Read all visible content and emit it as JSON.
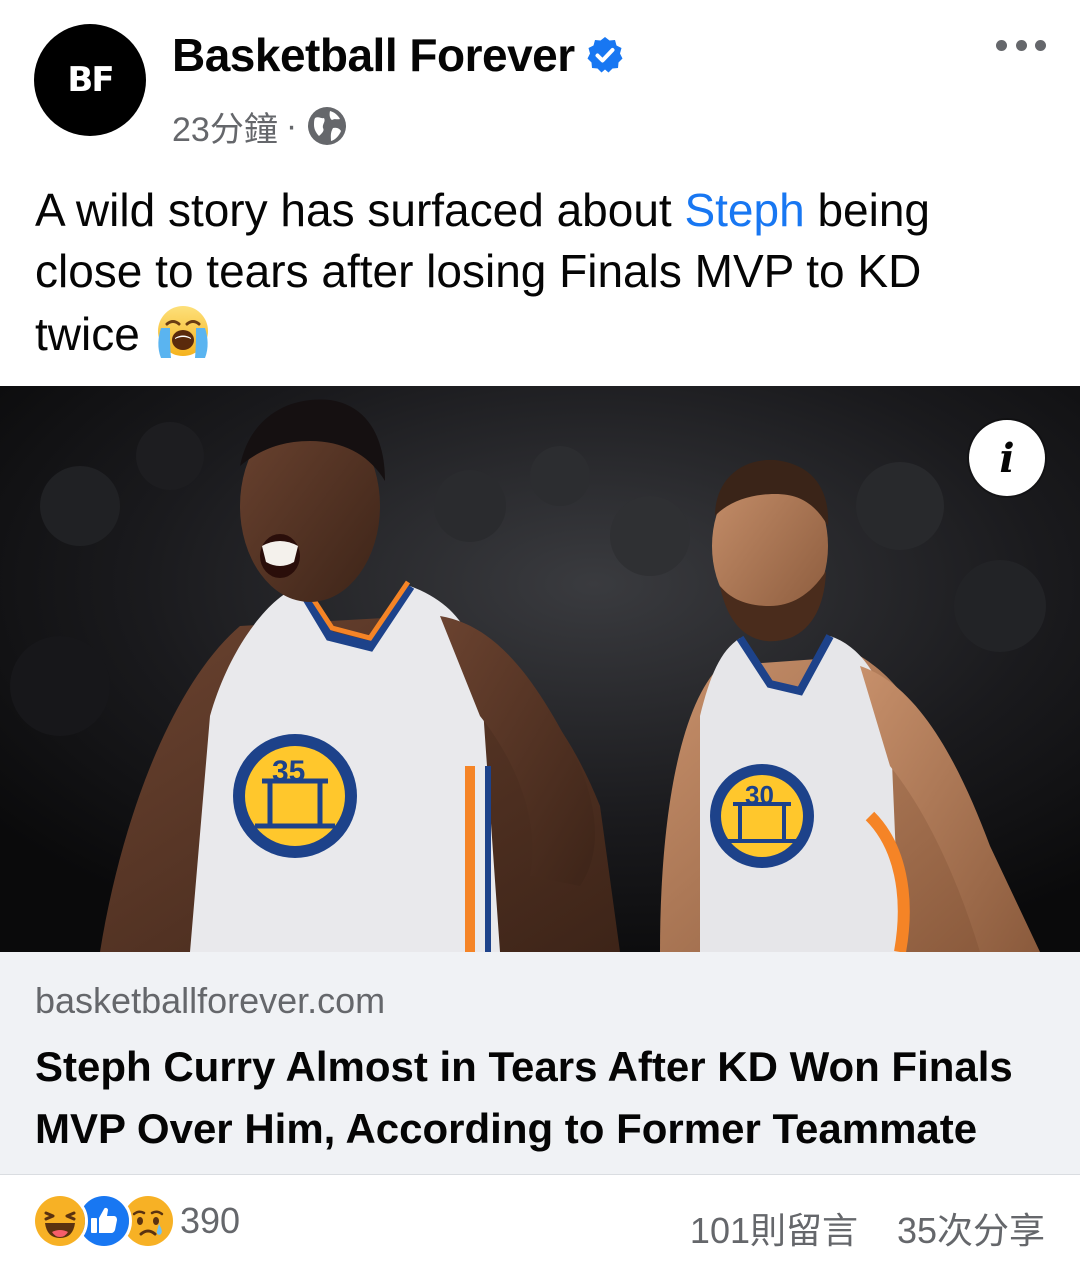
{
  "header": {
    "avatar_text": "BF",
    "page_name": "Basketball Forever",
    "verified_icon": "verified-badge-icon",
    "timestamp": "23分鐘",
    "separator": "·",
    "privacy_icon": "globe-icon",
    "more_icon": "more-options-icon"
  },
  "post": {
    "text_before": "A wild story has surfaced about ",
    "mention": "Steph",
    "text_after": " being close to tears after losing Finals MVP to KD twice ",
    "emoji_icon": "loudly-crying-face-icon"
  },
  "link_preview": {
    "image_icon": "info-icon",
    "domain": "basketballforever.com",
    "title": "Steph Curry Almost in Tears After KD Won Finals MVP Over Him, According to Former Teammate"
  },
  "engagement": {
    "reaction_icons": [
      "haha-reaction-icon",
      "like-reaction-icon",
      "sad-reaction-icon"
    ],
    "reaction_count": "390",
    "comments": "101則留言",
    "shares": "35次分享"
  },
  "colors": {
    "accent": "#1877f2",
    "secondary_text": "#65676b",
    "link_footer_bg": "#f0f2f5",
    "haha": "#f7b125",
    "like": "#1877f2"
  }
}
